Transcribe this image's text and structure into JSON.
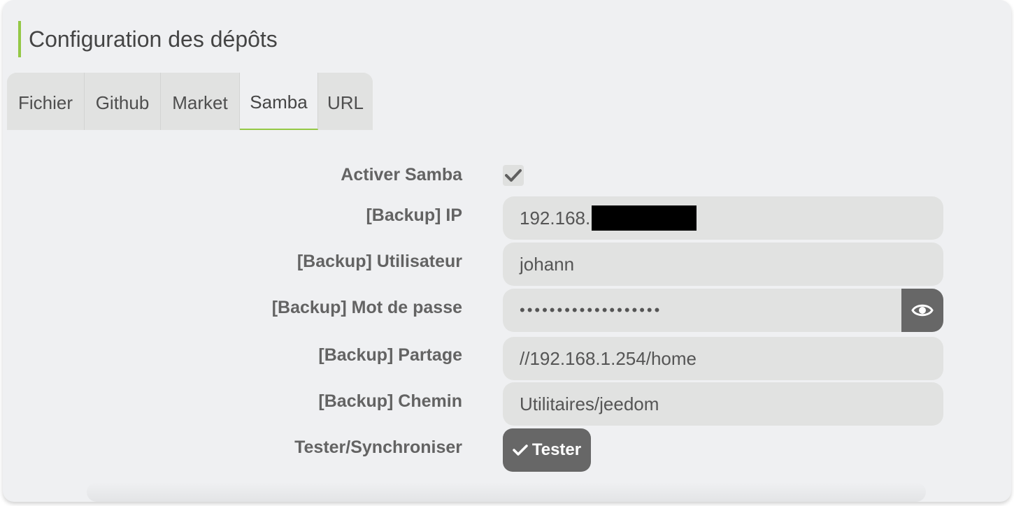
{
  "title": "Configuration des dépôts",
  "tabs": [
    {
      "label": "Fichier",
      "active": false
    },
    {
      "label": "Github",
      "active": false
    },
    {
      "label": "Market",
      "active": false
    },
    {
      "label": "Samba",
      "active": true
    },
    {
      "label": "URL",
      "active": false
    }
  ],
  "form": {
    "activer_samba": {
      "label": "Activer Samba",
      "checked": true
    },
    "ip": {
      "label": "[Backup] IP",
      "value": "192.168."
    },
    "utilisateur": {
      "label": "[Backup] Utilisateur",
      "value": "johann"
    },
    "mot_de_passe": {
      "label": "[Backup] Mot de passe",
      "value": "•••••••••••••••••••"
    },
    "partage": {
      "label": "[Backup] Partage",
      "value": "//192.168.1.254/home"
    },
    "chemin": {
      "label": "[Backup] Chemin",
      "value": "Utilitaires/jeedom"
    },
    "tester": {
      "label": "Tester/Synchroniser",
      "button_label": "Tester"
    }
  },
  "icons": {
    "checkbox": "check-icon",
    "password_toggle": "eye-icon",
    "tester": "check-icon"
  },
  "colors": {
    "accent": "#94c846",
    "button": "#676767",
    "panel": "#eff0f2",
    "input": "#e1e2e1"
  }
}
